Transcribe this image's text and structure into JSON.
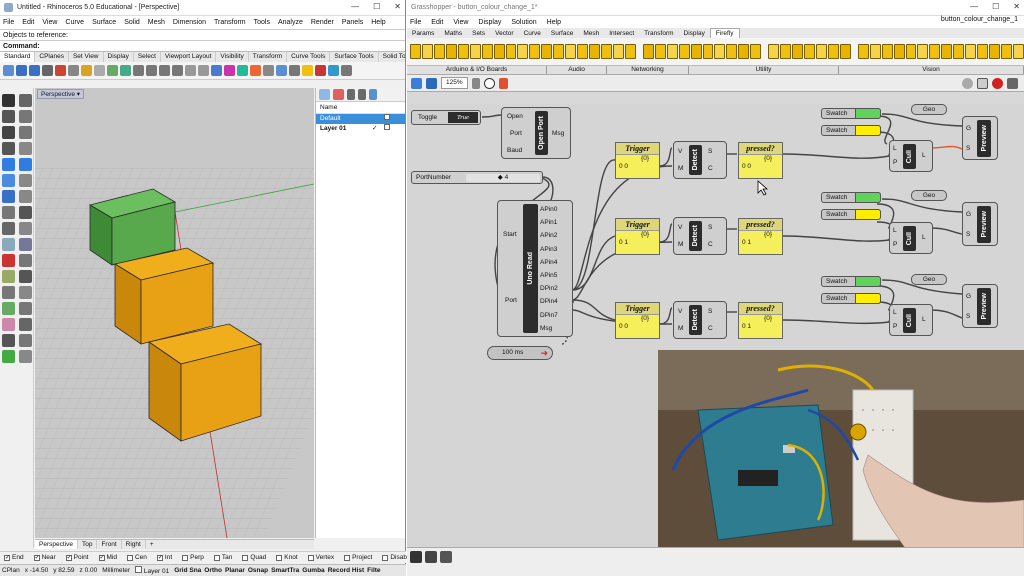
{
  "rhino": {
    "title": "Untitled - Rhinoceros 5.0 Educational - [Perspective]",
    "menu": [
      "File",
      "Edit",
      "View",
      "Curve",
      "Surface",
      "Solid",
      "Mesh",
      "Dimension",
      "Transform",
      "Tools",
      "Analyze",
      "Render",
      "Panels",
      "Help"
    ],
    "cmd_history": "Objects to reference:",
    "cmd_label": "Command:",
    "tabs": [
      "Standard",
      "CPlanes",
      "Set View",
      "Display",
      "Select",
      "Viewport Layout",
      "Visibility",
      "Transform",
      "Curve Tools",
      "Surface Tools",
      "Solid Tools"
    ],
    "viewport_label": "Perspective",
    "layers": {
      "col_name": "Name",
      "rows": [
        {
          "name": "Default",
          "selected": true,
          "check": ""
        },
        {
          "name": "Layer 01",
          "selected": false,
          "check": "✓"
        }
      ]
    },
    "viewport_tabs": [
      "Perspective",
      "Top",
      "Front",
      "Right"
    ],
    "osnaps": [
      {
        "label": "End",
        "checked": true
      },
      {
        "label": "Near",
        "checked": true
      },
      {
        "label": "Point",
        "checked": true
      },
      {
        "label": "Mid",
        "checked": true
      },
      {
        "label": "Cen",
        "checked": false
      },
      {
        "label": "Int",
        "checked": true
      },
      {
        "label": "Perp",
        "checked": false
      },
      {
        "label": "Tan",
        "checked": false
      },
      {
        "label": "Quad",
        "checked": false
      },
      {
        "label": "Knot",
        "checked": false
      },
      {
        "label": "Vertex",
        "checked": false
      },
      {
        "label": "Project",
        "checked": false
      },
      {
        "label": "Disable",
        "checked": false
      }
    ],
    "status": {
      "cplane": "CPlan",
      "x": "x -14.50",
      "y": "y 82.59",
      "z": "z 0.00",
      "units": "Millimeter",
      "layer": "Layer 01",
      "toggles": [
        "Grid Sna",
        "Ortho",
        "Planar",
        "Osnap",
        "SmartTra",
        "Gumba",
        "Record Hist",
        "Filte"
      ]
    }
  },
  "grasshopper": {
    "title": "Grasshopper - button_colour_change_1*",
    "doc_name": "button_colour_change_1",
    "menu": [
      "File",
      "Edit",
      "View",
      "Display",
      "Solution",
      "Help"
    ],
    "tabs": [
      "Params",
      "Maths",
      "Sets",
      "Vector",
      "Curve",
      "Surface",
      "Mesh",
      "Intersect",
      "Transform",
      "Display",
      "Firefly"
    ],
    "active_tab": "Firefly",
    "groups": [
      "Arduino & I/O Boards",
      "Audio",
      "Networking",
      "Utility",
      "Vision"
    ],
    "zoom": "125%",
    "toggle": {
      "label": "Toggle",
      "value": "True"
    },
    "open_port": {
      "title": "Open Port",
      "inputs": [
        "Open",
        "Port",
        "Baud"
      ],
      "output": "Msg"
    },
    "port_number": {
      "label": "PortNumber",
      "value": "◆ 4"
    },
    "uno_read": {
      "title": "Uno Read",
      "inputs": [
        "Start",
        "Port"
      ],
      "outputs": [
        "APin0",
        "APin1",
        "APin2",
        "APin3",
        "APin4",
        "APin5",
        "DPin2",
        "DPin4",
        "DPin7",
        "Msg"
      ]
    },
    "timer": "100 ms",
    "rows": [
      {
        "trigger": "Trigger",
        "trigger_idx": "{0}",
        "trigger_val": "0  0",
        "pressed": "pressed?",
        "pressed_idx": "{0}",
        "pressed_val": "0  0",
        "color": "#5fd35a"
      },
      {
        "trigger": "Trigger",
        "trigger_idx": "{0}",
        "trigger_val": "0  1",
        "pressed": "pressed?",
        "pressed_idx": "{0}",
        "pressed_val": "0  1",
        "color": "#5fd35a"
      },
      {
        "trigger": "Trigger",
        "trigger_idx": "{0}",
        "trigger_val": "0  0",
        "pressed": "pressed?",
        "pressed_idx": "{0}",
        "pressed_val": "0  1",
        "color": "#5fd35a"
      }
    ],
    "detect": {
      "title": "Detect",
      "inputs": [
        "V",
        "M"
      ],
      "outputs": [
        "S",
        "C"
      ]
    },
    "swatch_label": "Swatch",
    "swatch_yellow": "#ffee00",
    "geo_label": "Geo",
    "cull": {
      "title": "Cull",
      "inputs": [
        "L",
        "P"
      ],
      "output": "L"
    },
    "preview": {
      "title": "Preview",
      "inputs": [
        "G",
        "S"
      ]
    }
  }
}
